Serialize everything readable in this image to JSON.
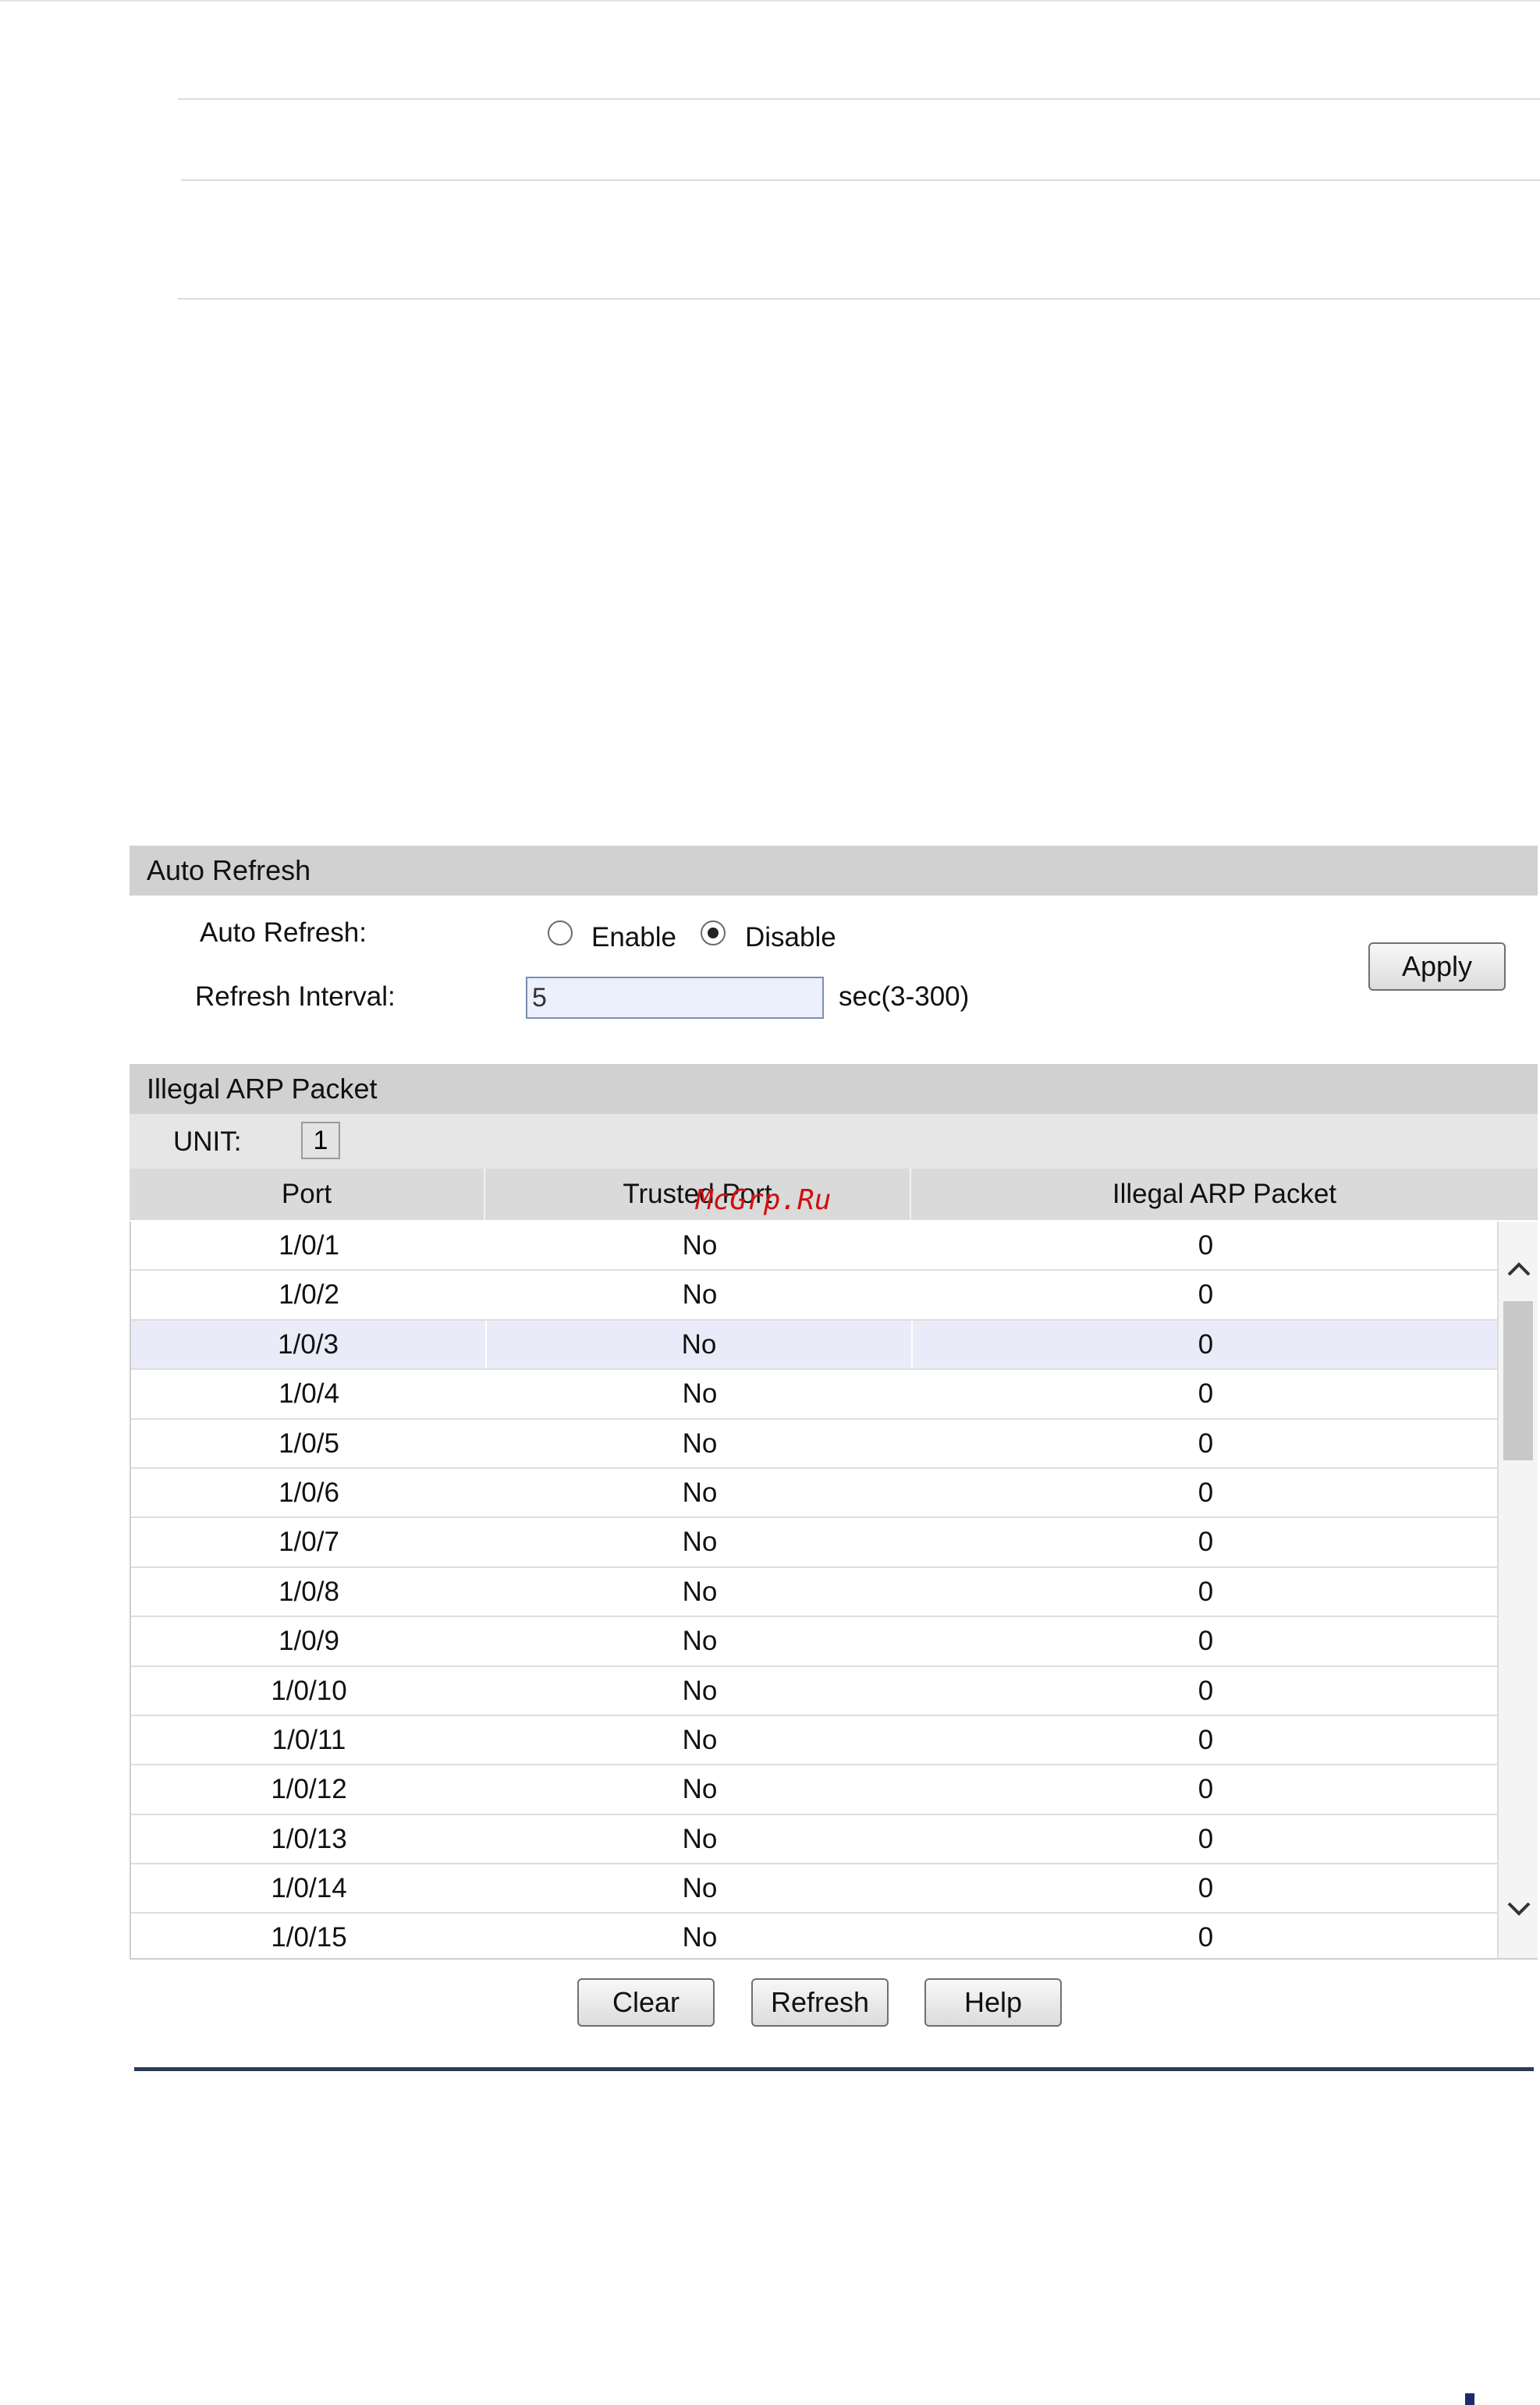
{
  "auto_refresh": {
    "section_title": "Auto Refresh",
    "auto_refresh_label": "Auto Refresh:",
    "enable_label": "Enable",
    "disable_label": "Disable",
    "selected": "Disable",
    "interval_label": "Refresh Interval:",
    "interval_value": "5",
    "interval_hint": "sec(3-300)",
    "apply_label": "Apply"
  },
  "illegal_arp": {
    "section_title": "Illegal ARP Packet",
    "unit_label": "UNIT:",
    "unit_value": "1",
    "columns": [
      "Port",
      "Trusted Port",
      "Illegal ARP Packet"
    ],
    "rows": [
      [
        "1/0/1",
        "No",
        "0"
      ],
      [
        "1/0/2",
        "No",
        "0"
      ],
      [
        "1/0/3",
        "No",
        "0"
      ],
      [
        "1/0/4",
        "No",
        "0"
      ],
      [
        "1/0/5",
        "No",
        "0"
      ],
      [
        "1/0/6",
        "No",
        "0"
      ],
      [
        "1/0/7",
        "No",
        "0"
      ],
      [
        "1/0/8",
        "No",
        "0"
      ],
      [
        "1/0/9",
        "No",
        "0"
      ],
      [
        "1/0/10",
        "No",
        "0"
      ],
      [
        "1/0/11",
        "No",
        "0"
      ],
      [
        "1/0/12",
        "No",
        "0"
      ],
      [
        "1/0/13",
        "No",
        "0"
      ],
      [
        "1/0/14",
        "No",
        "0"
      ],
      [
        "1/0/15",
        "No",
        "0"
      ]
    ],
    "highlighted_row": "1/0/3"
  },
  "buttons": {
    "clear_label": "Clear",
    "refresh_label": "Refresh",
    "help_label": "Help"
  },
  "watermark": "McGrp.Ru",
  "icons": {
    "scroll_up": "chevron-up-icon",
    "scroll_down": "chevron-down-icon"
  },
  "colors": {
    "header_bg": "#d1d1d1",
    "highlight_row": "#e9ebf8",
    "footer_rule": "#2a3b52",
    "input_bg": "#eceffc"
  }
}
